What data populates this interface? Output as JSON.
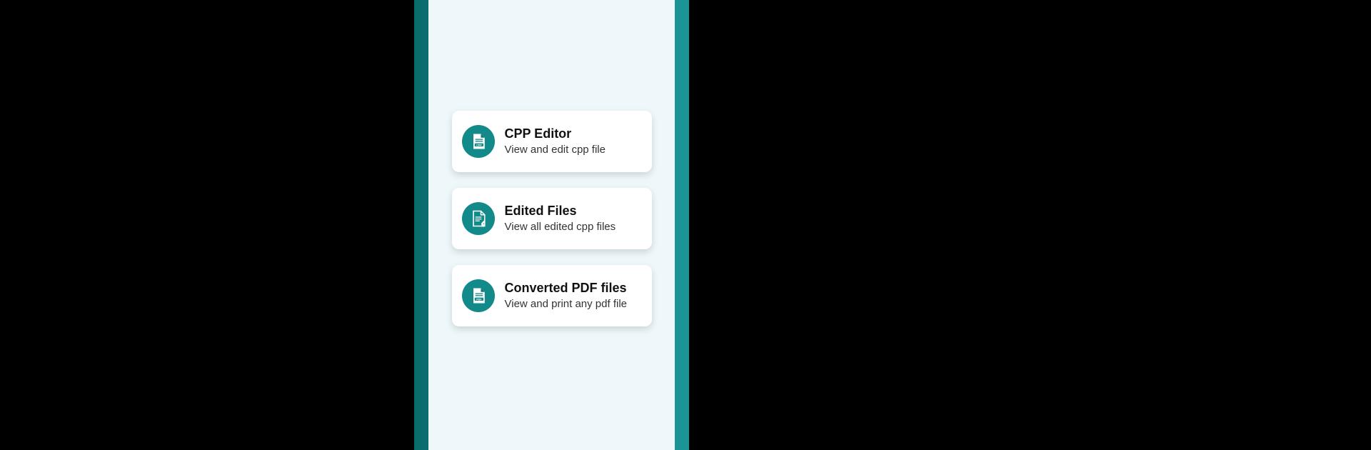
{
  "menu": {
    "items": [
      {
        "icon": "cpp-file-icon",
        "title": "CPP Editor",
        "subtitle": "View and edit cpp file"
      },
      {
        "icon": "edited-file-icon",
        "title": "Edited Files",
        "subtitle": "View all edited cpp files"
      },
      {
        "icon": "pdf-file-icon",
        "title": "Converted PDF files",
        "subtitle": "View and print any pdf file"
      }
    ]
  },
  "colors": {
    "accent": "#128a8a",
    "background": "#eef8fb",
    "frame_gradient_start": "#0a6b6b",
    "frame_gradient_end": "#1a9595"
  }
}
